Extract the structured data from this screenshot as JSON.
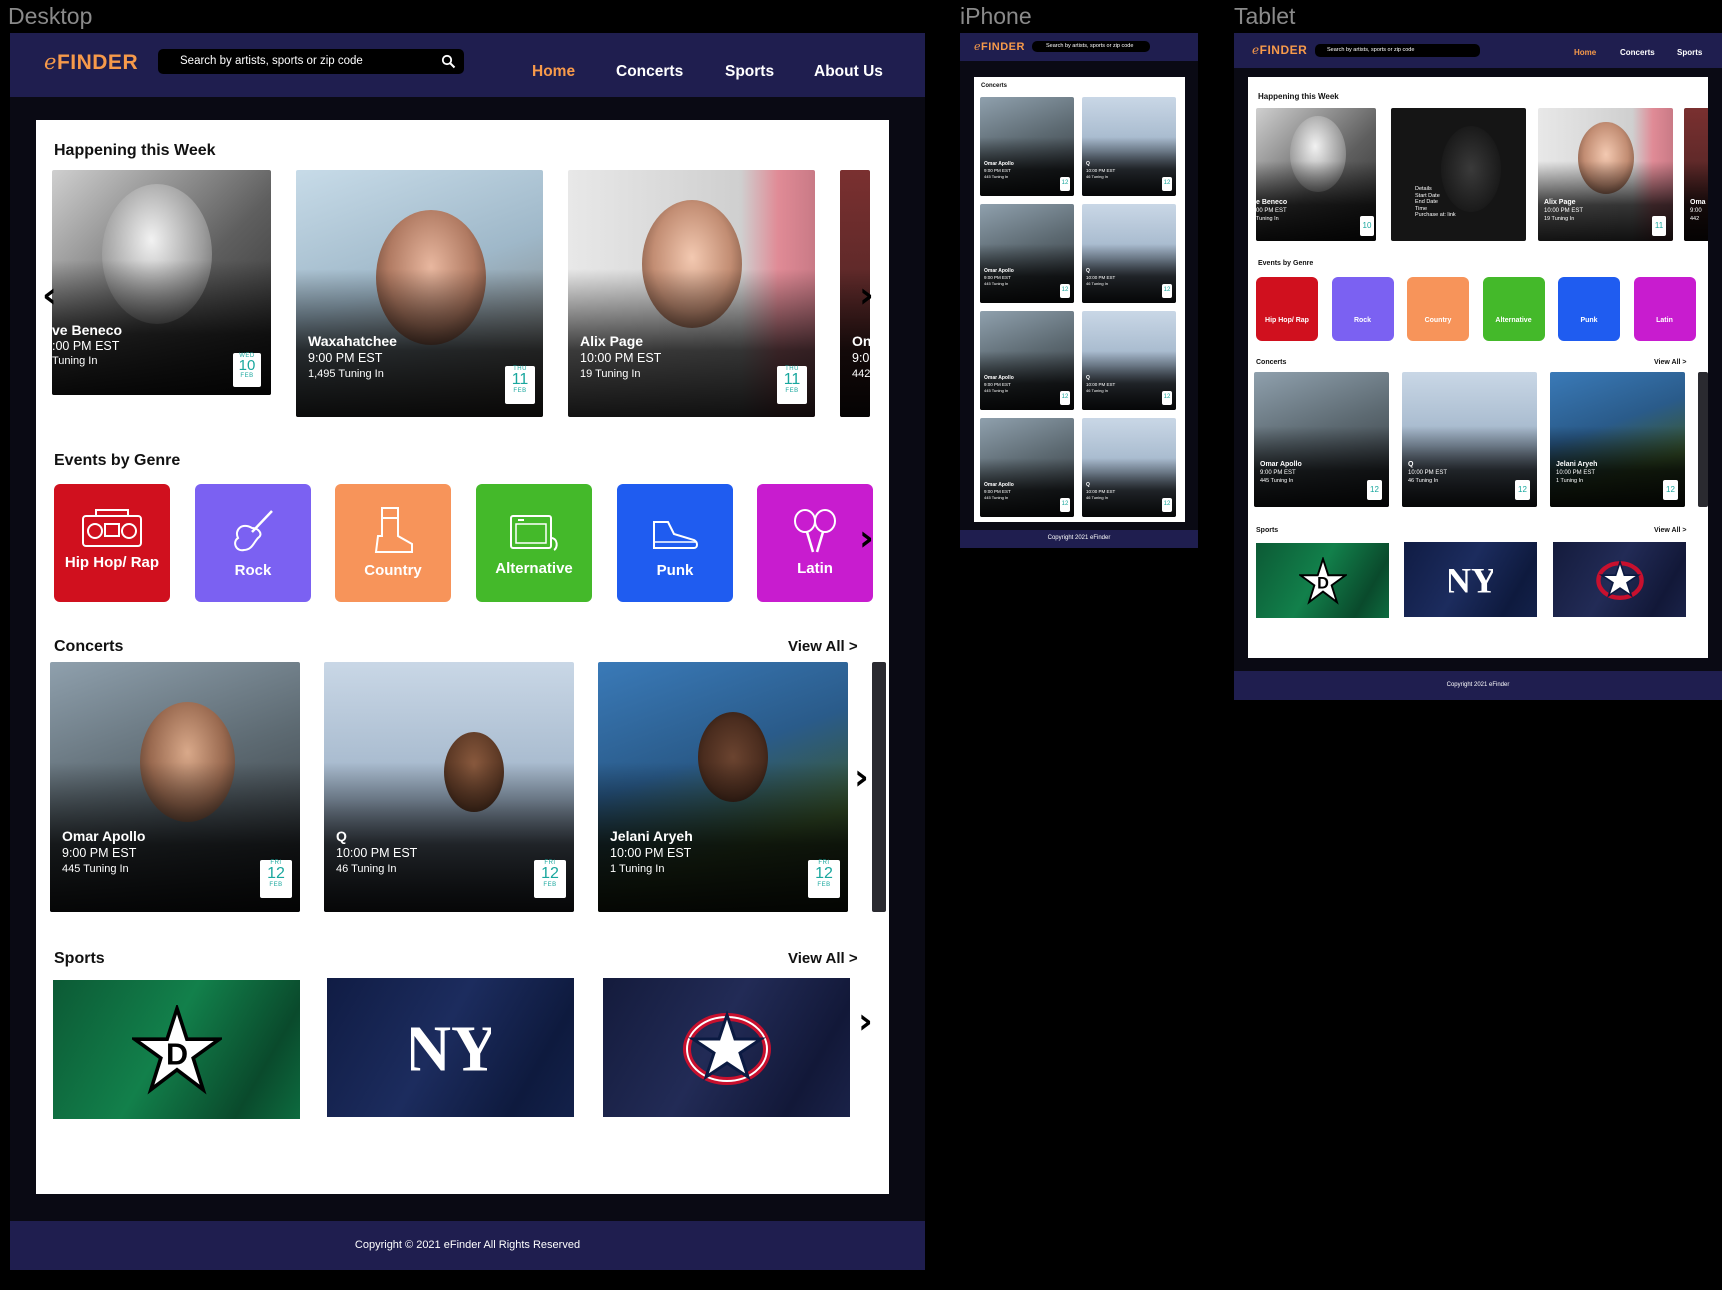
{
  "frames": {
    "desktop": "Desktop",
    "iphone": "iPhone",
    "tablet": "Tablet"
  },
  "brand": {
    "logo_e": "e",
    "logo_rest": "FINDER"
  },
  "search": {
    "placeholder": "Search by artists, sports or zip code"
  },
  "nav": {
    "home": "Home",
    "concerts": "Concerts",
    "sports": "Sports",
    "about": "About Us"
  },
  "sections": {
    "happening": "Happening this Week",
    "genres": "Events by Genre",
    "concerts": "Concerts",
    "sports": "Sports",
    "view_all": "View All >"
  },
  "happening": [
    {
      "name": "ve Beneco",
      "time": ":00 PM EST",
      "tuning": "Tuning In",
      "dow": "WED",
      "day": "10",
      "month": "FEB"
    },
    {
      "name": "Waxahatchee",
      "time": "9:00 PM EST",
      "tuning": "1,495 Tuning In",
      "dow": "THU",
      "day": "11",
      "month": "FEB"
    },
    {
      "name": "Alix Page",
      "time": "10:00 PM EST",
      "tuning": "19 Tuning In",
      "dow": "THU",
      "day": "11",
      "month": "FEB"
    },
    {
      "name": "On",
      "time": "9:0",
      "tuning": "442"
    }
  ],
  "genres": [
    {
      "label": "Hip Hop/ Rap",
      "color": "#d0101e",
      "icon": "boombox-icon"
    },
    {
      "label": "Rock",
      "color": "#7b61f2",
      "icon": "guitar-icon"
    },
    {
      "label": "Country",
      "color": "#f7945a",
      "icon": "cowboy-boot-icon"
    },
    {
      "label": "Alternative",
      "color": "#44b92a",
      "icon": "amplifier-icon"
    },
    {
      "label": "Punk",
      "color": "#1f5cf0",
      "icon": "sneaker-icon"
    },
    {
      "label": "Latin",
      "color": "#c81ccf",
      "icon": "maracas-icon"
    }
  ],
  "concerts": [
    {
      "name": "Omar Apollo",
      "time": "9:00 PM EST",
      "tuning": "445 Tuning In",
      "dow": "FRI",
      "day": "12",
      "month": "FEB"
    },
    {
      "name": "Q",
      "time": "10:00 PM EST",
      "tuning": "46 Tuning In",
      "dow": "FRI",
      "day": "12",
      "month": "FEB"
    },
    {
      "name": "Jelani Aryeh",
      "time": "10:00 PM EST",
      "tuning": "1 Tuning In",
      "dow": "FRI",
      "day": "12",
      "month": "FEB"
    }
  ],
  "sports": [
    {
      "team": "Dallas Stars",
      "icon": "stars-logo-icon",
      "color": "#0d6b3f"
    },
    {
      "team": "New York Yankees",
      "icon": "yankees-logo-icon",
      "color": "#13214a"
    },
    {
      "team": "Columbus Blue Jackets",
      "icon": "blue-jackets-logo-icon",
      "color": "#1a2248"
    }
  ],
  "footer": {
    "desktop": "Copyright © 2021 eFinder All Rights Reserved",
    "small": "Copyright 2021 eFinder"
  },
  "iphone_cards": [
    {
      "name": "Omar Apollo",
      "time": "9:00 PM EST",
      "tuning": "445 Tuning In",
      "day": "12"
    },
    {
      "name": "Q",
      "time": "10:00 PM EST",
      "tuning": "46 Tuning In",
      "day": "12"
    }
  ],
  "tablet": {
    "happening": [
      {
        "name": "e Beneco",
        "time": "00 PM EST",
        "tuning": "Tuning In",
        "day": "10"
      },
      {
        "details": "Details",
        "start": "Start Date",
        "end": "End Date",
        "time": "Time",
        "purchase": "Purchase at: link"
      },
      {
        "name": "Alix Page",
        "time": "10:00 PM EST",
        "tuning": "19 Tuning In",
        "day": "11"
      },
      {
        "name": "Oma",
        "time": "9:00",
        "tuning": "442"
      }
    ],
    "concerts": [
      {
        "name": "Omar Apollo",
        "time": "9:00 PM EST",
        "tuning": "445 Tuning In",
        "day": "12"
      },
      {
        "name": "Q",
        "time": "10:00 PM EST",
        "tuning": "46 Tuning In",
        "day": "12"
      },
      {
        "name": "Jelani Aryeh",
        "time": "10:00 PM EST",
        "tuning": "1 Tuning In",
        "day": "12"
      }
    ]
  },
  "colors": {
    "navbar": "#1f1e4f",
    "accent": "#f79a4a",
    "date": "#19a79e"
  }
}
